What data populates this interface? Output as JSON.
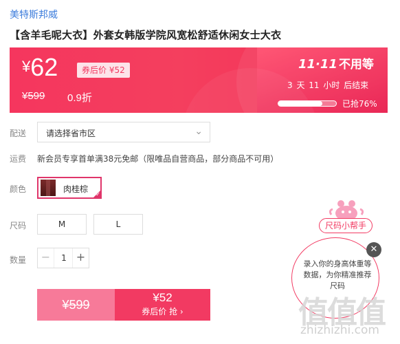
{
  "store": {
    "brand": "美特斯邦威"
  },
  "product": {
    "title": "【含羊毛呢大衣】外套女韩版学院风宽松舒适休闲女士大衣"
  },
  "price_bar": {
    "currency": "¥",
    "price": "62",
    "after_coupon_label": "券后价 ¥52",
    "original_price": "¥599",
    "discount": "0.9折",
    "promo_logo": "11·11",
    "promo_sub": "不用等",
    "countdown": "3 天 11 小时 后结束",
    "grabbed_percent": 0.76,
    "grabbed_label": "已抢76%"
  },
  "shipping": {
    "label": "配送",
    "selected": "请选择省市区"
  },
  "freight": {
    "label": "运费",
    "text": "新会员专享首单满38元免邮（限唯品自营商品，部分商品不可用）"
  },
  "color": {
    "label": "颜色",
    "selected": "肉桂棕"
  },
  "size": {
    "label": "尺码",
    "options": [
      "M",
      "L"
    ]
  },
  "quantity": {
    "label": "数量",
    "value": "1"
  },
  "buy": {
    "original_price": "¥599",
    "price": "¥52",
    "action": "券后价 抢 ›"
  },
  "size_helper": {
    "button_label": "尺码小帮手",
    "bubble_text": "录入你的身高体重等数据，为你精准推荐尺码"
  },
  "watermark": {
    "logo": "值值值",
    "url": "zhizhizhi.com"
  },
  "colors": {
    "accent": "#f23a62",
    "link": "#3d7ddc"
  }
}
